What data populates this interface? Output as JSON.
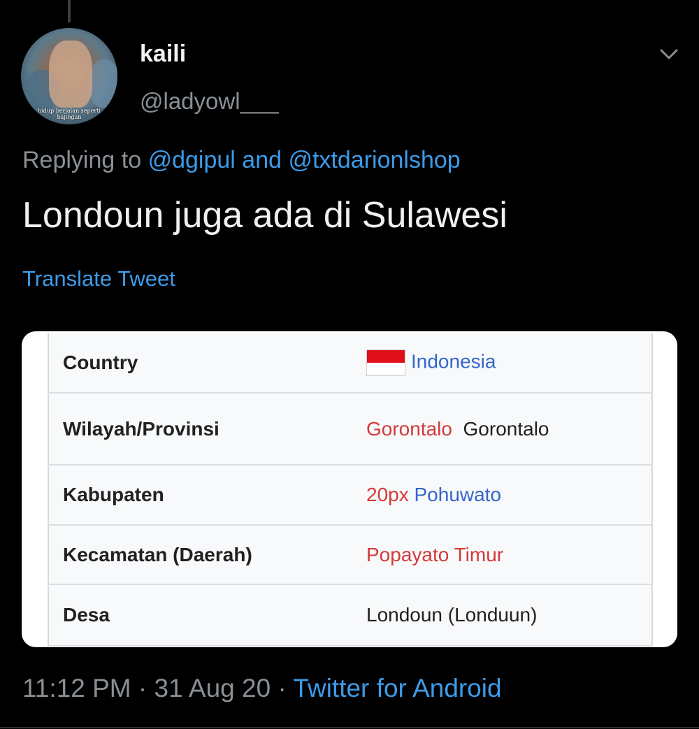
{
  "tweet": {
    "author": {
      "display_name": "kaili",
      "handle": "@ladyowl___",
      "avatar_caption": "hidup berjalan seperti bajingan"
    },
    "replying_to": {
      "prefix": "Replying to",
      "mention1": "@dgipul",
      "joiner": "and",
      "mention2": "@txtdarionlshop"
    },
    "text": "Londoun juga ada di Sulawesi",
    "translate_label": "Translate Tweet",
    "footer": {
      "time": "11:12 PM",
      "separator": "·",
      "date": "31 Aug 20",
      "source": "Twitter for Android"
    },
    "menu_icon": "chevron-down-icon"
  },
  "media_table": {
    "rows": [
      {
        "label": "Country",
        "value": "Indonesia",
        "flag_icon": "indonesia-flag-icon"
      },
      {
        "label": "Wilayah/Provinsi",
        "value_link": "Gorontalo",
        "value_text": "Gorontalo"
      },
      {
        "label": "Kabupaten",
        "value_prefix": "20px",
        "value_link": "Pohuwato"
      },
      {
        "label": "Kecamatan (Daerah)",
        "value_link": "Popayato Timur"
      },
      {
        "label": "Desa",
        "value": "Londoun (Londuun)"
      }
    ]
  },
  "colors": {
    "background": "#000000",
    "link_blue": "#3d9be9",
    "muted_gray": "#8a9096",
    "wiki_link_blue": "#3366cc",
    "wiki_link_red": "#d33a3a"
  }
}
